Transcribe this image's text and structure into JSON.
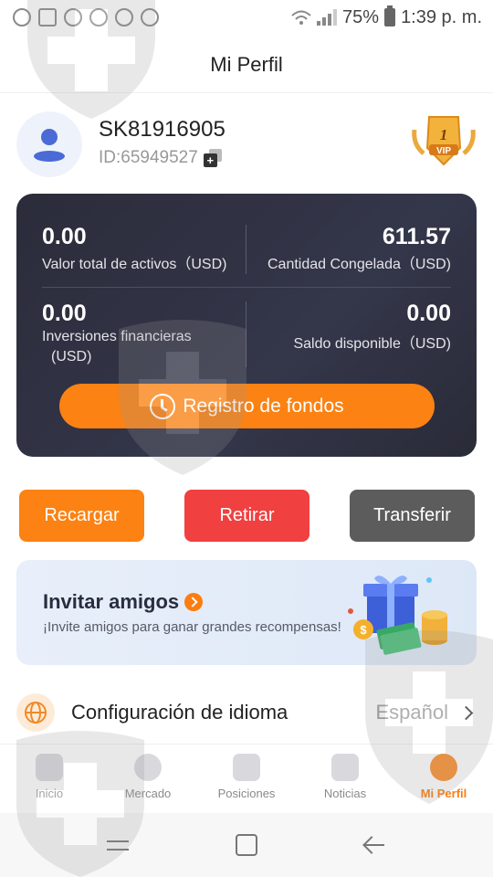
{
  "status_bar": {
    "battery_percent": "75%",
    "time": "1:39 p. m."
  },
  "header": {
    "title": "Mi Perfil"
  },
  "profile": {
    "username": "SK81916905",
    "user_id": "ID:65949527",
    "vip_level": "1",
    "vip_label": "VIP"
  },
  "assets": {
    "total_value": "0.00",
    "total_label": "Valor total de activos（USD)",
    "frozen_value": "611.57",
    "frozen_label": "Cantidad Congelada（USD)",
    "investments_value": "0.00",
    "investments_label_1": "Inversiones financieras",
    "investments_label_2": "(USD)",
    "available_value": "0.00",
    "available_label": "Saldo disponible（USD)",
    "fund_record_label": "Registro de fondos"
  },
  "actions": {
    "recharge": "Recargar",
    "withdraw": "Retirar",
    "transfer": "Transferir"
  },
  "invite": {
    "title": "Invitar amigos",
    "subtitle": "¡Invite amigos para ganar grandes recompensas!"
  },
  "settings": {
    "language_label": "Configuración de idioma",
    "language_value": "Español"
  },
  "tabs": [
    {
      "label": "Inicio"
    },
    {
      "label": "Mercado"
    },
    {
      "label": "Posiciones"
    },
    {
      "label": "Noticias"
    },
    {
      "label": "Mi Perfil"
    }
  ],
  "colors": {
    "accent": "#fb8213",
    "withdraw": "#f04040",
    "transfer": "#5c5c5c",
    "card_dark": "#2e2f3e",
    "active_tab": "#fb7d10"
  }
}
